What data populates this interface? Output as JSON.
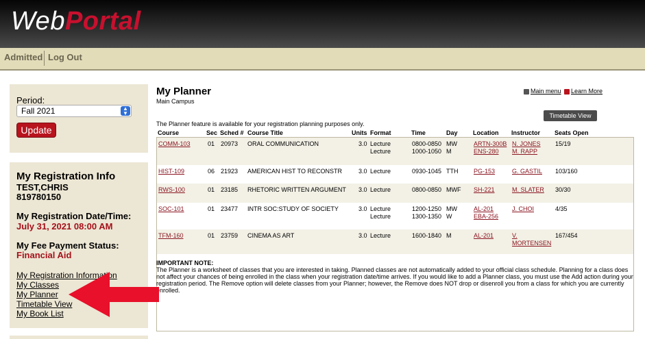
{
  "header": {
    "logo_web": "Web",
    "logo_portal": "Portal"
  },
  "nav": {
    "items": [
      "Admitted",
      "Log Out"
    ]
  },
  "sidebar": {
    "period_label": "Period:",
    "period_value": "Fall 2021",
    "update_label": "Update",
    "reg_title": "My Registration Info",
    "student_name": "TEST,CHRIS",
    "student_id": "819780150",
    "reg_date_label": "My Registration Date/Time:",
    "reg_date_value": "July 31, 2021 08:00 AM",
    "fee_label": "My Fee Payment Status:",
    "fee_value": "Financial Aid",
    "links": [
      "My Registration Information",
      "My Classes",
      "My Planner",
      "Timetable View",
      "My Book List"
    ]
  },
  "main": {
    "title": "My Planner",
    "campus": "Main Campus",
    "main_menu": "Main menu",
    "learn_more": "Learn More",
    "timetable_button": "Timetable View",
    "info": "The Planner feature is available for your registration planning purposes only.",
    "headers": [
      "Course",
      "Sec",
      "Sched #",
      "Course Title",
      "Units",
      "Format",
      "Time",
      "Day",
      "Location",
      "Instructor",
      "Seats Open"
    ],
    "rows": [
      {
        "course": "COMM-103",
        "sec": "01",
        "sched": "20973",
        "title": "ORAL COMMUNICATION",
        "units": "3.0",
        "format": [
          "Lecture",
          "Lecture"
        ],
        "time": [
          "0800-0850",
          "1000-1050"
        ],
        "day": [
          "MW",
          "M"
        ],
        "location": [
          "ARTN-300B",
          "ENS-280"
        ],
        "instructor": [
          "N. JONES",
          "M. RAPP"
        ],
        "seats": "15/19"
      },
      {
        "course": "HIST-109",
        "sec": "06",
        "sched": "21923",
        "title": "AMERICAN HIST TO RECONSTR",
        "units": "3.0",
        "format": [
          "Lecture"
        ],
        "time": [
          "0930-1045"
        ],
        "day": [
          "TTH"
        ],
        "location": [
          "PG-153"
        ],
        "instructor": [
          "G. GASTIL"
        ],
        "seats": "103/160"
      },
      {
        "course": "RWS-100",
        "sec": "01",
        "sched": "23185",
        "title": "RHETORIC WRITTEN ARGUMENT",
        "units": "3.0",
        "format": [
          "Lecture"
        ],
        "time": [
          "0800-0850"
        ],
        "day": [
          "MWF"
        ],
        "location": [
          "SH-221"
        ],
        "instructor": [
          "M. SLATER"
        ],
        "seats": "30/30"
      },
      {
        "course": "SOC-101",
        "sec": "01",
        "sched": "23477",
        "title": "INTR SOC:STUDY OF SOCIETY",
        "units": "3.0",
        "format": [
          "Lecture",
          "Lecture"
        ],
        "time": [
          "1200-1250",
          "1300-1350"
        ],
        "day": [
          "MW",
          "W"
        ],
        "location": [
          "AL-201",
          "EBA-256"
        ],
        "instructor": [
          "J. CHOI"
        ],
        "seats": "4/35"
      },
      {
        "course": "TFM-160",
        "sec": "01",
        "sched": "23759",
        "title": "CINEMA AS ART",
        "units": "3.0",
        "format": [
          "Lecture"
        ],
        "time": [
          "1600-1840"
        ],
        "day": [
          "M"
        ],
        "location": [
          "AL-201"
        ],
        "instructor": [
          "V.",
          "MORTENSEN"
        ],
        "seats": "167/454"
      }
    ],
    "note_title": "IMPORTANT NOTE:",
    "note_text": "The Planner is a worksheet of classes that you are interested in taking. Planned classes are not automatically added to your official class schedule. Planning for a class does not affect your chances of being enrolled in the class when your registration date/time arrives. If you would like to add a Planner class, you must use the Add action during your registration period. The Remove option will delete classes from your Planner; however, the Remove does NOT drop or disenroll you from a class for which you are currently enrolled."
  },
  "colors": {
    "accent_red": "#b8141e",
    "panel": "#ece6d4",
    "nav": "#e2dcb9",
    "arrow": "#e8102a"
  }
}
